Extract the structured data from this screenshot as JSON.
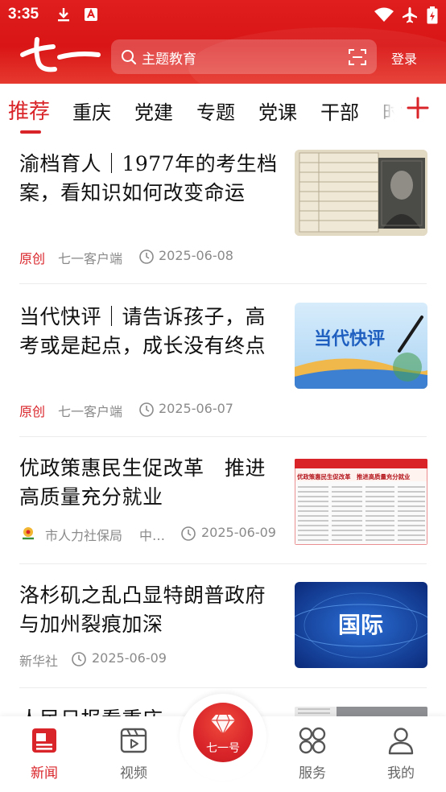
{
  "status_bar": {
    "time": "3:35"
  },
  "header": {
    "logo_text": "七一",
    "search_placeholder": "主题教育",
    "login_label": "登录"
  },
  "tabs": [
    {
      "label": "推荐",
      "active": true
    },
    {
      "label": "重庆",
      "active": false
    },
    {
      "label": "党建",
      "active": false
    },
    {
      "label": "专题",
      "active": false
    },
    {
      "label": "党课",
      "active": false
    },
    {
      "label": "干部",
      "active": false
    },
    {
      "label": "时",
      "active": false
    }
  ],
  "news": [
    {
      "title": "渝档育人｜1977年的考生档案，看知识如何改变命运",
      "tag": "原创",
      "source": "七一客户端",
      "date": "2025-06-08",
      "thumb_caption": ""
    },
    {
      "title": "当代快评｜请告诉孩子，高考或是起点，成长没有终点",
      "tag": "原创",
      "source": "七一客户端",
      "date": "2025-06-07",
      "thumb_caption": "当代快评"
    },
    {
      "title": "优政策惠民生促改革　推进高质量充分就业",
      "tag": "",
      "source": "市人力社保局",
      "source_extra": "中…",
      "date": "2025-06-09",
      "thumb_caption": "优政策惠民生促改革　推进高质量充分就业"
    },
    {
      "title": "洛杉矶之乱凸显特朗普政府与加州裂痕加深",
      "tag": "",
      "source": "新华社",
      "date": "2025-06-09",
      "thumb_caption": "国际"
    },
    {
      "title": "人民日报看重庆",
      "tag": "",
      "source": "",
      "date": "",
      "thumb_caption": ""
    }
  ],
  "bottom_nav": {
    "news": "新闻",
    "video": "视频",
    "center": "七一号",
    "service": "服务",
    "mine": "我的"
  },
  "colors": {
    "brand_red": "#d9252a",
    "header_red": "#e01e1e"
  }
}
